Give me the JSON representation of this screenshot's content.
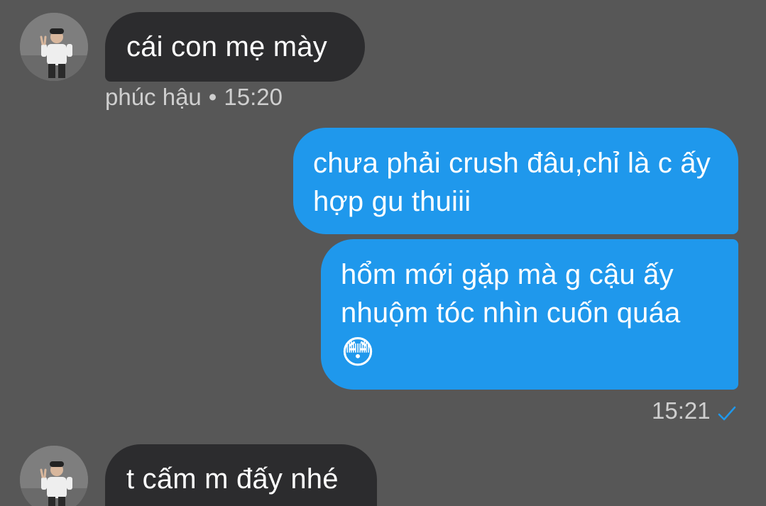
{
  "thread": {
    "messages": [
      {
        "direction": "incoming",
        "text": "cái con mẹ mày"
      },
      {
        "direction": "outgoing",
        "text": "chưa phải crush đâu,chỉ là c ấy hợp gu thuiii"
      },
      {
        "direction": "outgoing",
        "text": "hổm mới gặp mà g cậu ấy nhuộm tóc nhìn cuốn quáa",
        "emoji": "😳"
      },
      {
        "direction": "incoming",
        "text": "t cấm m đấy nhé"
      }
    ],
    "incoming_meta": {
      "sender": "phúc hậu",
      "separator": "•",
      "time": "15:20"
    },
    "outgoing_meta": {
      "time": "15:21",
      "status_icon": "checkmark-icon"
    }
  },
  "colors": {
    "background": "#575757",
    "incoming_bubble": "#2c2c2e",
    "outgoing_bubble": "#1f98ec",
    "meta_text": "#cfcfcf",
    "check": "#1f98ec"
  }
}
